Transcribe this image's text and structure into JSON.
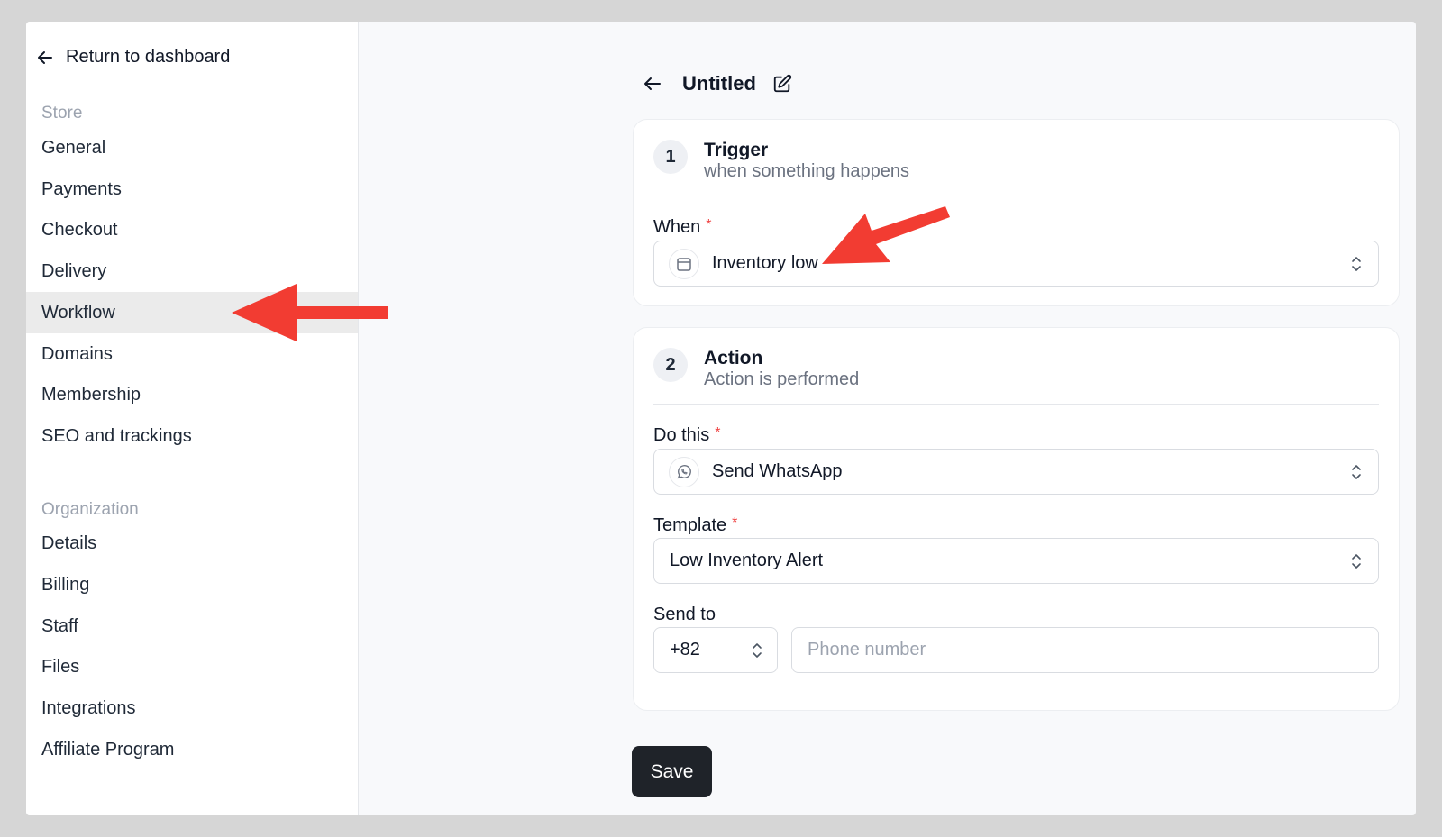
{
  "sidebar": {
    "return_label": "Return to dashboard",
    "store_section": "Store",
    "store_items": [
      "General",
      "Payments",
      "Checkout",
      "Delivery",
      "Workflow",
      "Domains",
      "Membership",
      "SEO and trackings"
    ],
    "org_section": "Organization",
    "org_items": [
      "Details",
      "Billing",
      "Staff",
      "Files",
      "Integrations",
      "Affiliate Program"
    ],
    "active_item": "Workflow"
  },
  "header": {
    "title": "Untitled"
  },
  "trigger": {
    "step": "1",
    "title": "Trigger",
    "subtitle": "when something happens",
    "when_label": "When",
    "when_value": "Inventory low"
  },
  "action": {
    "step": "2",
    "title": "Action",
    "subtitle": "Action is performed",
    "do_label": "Do this",
    "do_value": "Send WhatsApp",
    "template_label": "Template",
    "template_value": "Low Inventory Alert",
    "send_label": "Send to",
    "country_code": "+82",
    "phone_placeholder": "Phone number"
  },
  "save_label": "Save",
  "required_mark": "*",
  "colors": {
    "annotation_arrow": "#f23c32",
    "active_bg": "#ebebeb",
    "save_bg": "#1f2329"
  }
}
